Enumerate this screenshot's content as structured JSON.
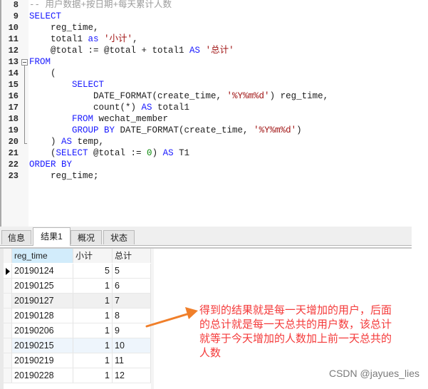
{
  "editor": {
    "lines": [
      {
        "n": "8",
        "parts": [
          {
            "t": "-- 用户数据+按日期+每天累计人数",
            "c": "cmt"
          }
        ]
      },
      {
        "n": "9",
        "parts": [
          {
            "t": "SELECT",
            "c": "kw"
          }
        ]
      },
      {
        "n": "10",
        "parts": [
          {
            "t": "    reg_time,",
            "c": ""
          }
        ]
      },
      {
        "n": "11",
        "parts": [
          {
            "t": "    total1 ",
            "c": ""
          },
          {
            "t": "as",
            "c": "kw"
          },
          {
            "t": " ",
            "c": ""
          },
          {
            "t": "'小计'",
            "c": "str"
          },
          {
            "t": ",",
            "c": ""
          }
        ]
      },
      {
        "n": "12",
        "parts": [
          {
            "t": "    @total := @total + total1 ",
            "c": ""
          },
          {
            "t": "AS",
            "c": "kw"
          },
          {
            "t": " ",
            "c": ""
          },
          {
            "t": "'总计'",
            "c": "str"
          }
        ]
      },
      {
        "n": "13",
        "parts": [
          {
            "t": "FROM",
            "c": "kw"
          }
        ]
      },
      {
        "n": "14",
        "parts": [
          {
            "t": "    (",
            "c": ""
          }
        ]
      },
      {
        "n": "15",
        "parts": [
          {
            "t": "        ",
            "c": ""
          },
          {
            "t": "SELECT",
            "c": "kw"
          }
        ]
      },
      {
        "n": "16",
        "parts": [
          {
            "t": "            DATE_FORMAT(create_time, ",
            "c": ""
          },
          {
            "t": "'%Y%m%d'",
            "c": "str"
          },
          {
            "t": ") reg_time,",
            "c": ""
          }
        ]
      },
      {
        "n": "17",
        "parts": [
          {
            "t": "            count(*) ",
            "c": ""
          },
          {
            "t": "AS",
            "c": "kw"
          },
          {
            "t": " total1",
            "c": ""
          }
        ]
      },
      {
        "n": "18",
        "parts": [
          {
            "t": "        ",
            "c": ""
          },
          {
            "t": "FROM",
            "c": "kw"
          },
          {
            "t": " wechat_member",
            "c": ""
          }
        ]
      },
      {
        "n": "19",
        "parts": [
          {
            "t": "        ",
            "c": ""
          },
          {
            "t": "GROUP BY",
            "c": "kw"
          },
          {
            "t": " DATE_FORMAT(create_time, ",
            "c": ""
          },
          {
            "t": "'%Y%m%d'",
            "c": "str"
          },
          {
            "t": ")",
            "c": ""
          }
        ]
      },
      {
        "n": "20",
        "parts": [
          {
            "t": "    ) ",
            "c": ""
          },
          {
            "t": "AS",
            "c": "kw"
          },
          {
            "t": " temp,",
            "c": ""
          }
        ]
      },
      {
        "n": "21",
        "parts": [
          {
            "t": "    (",
            "c": ""
          },
          {
            "t": "SELECT",
            "c": "kw"
          },
          {
            "t": " @total := ",
            "c": ""
          },
          {
            "t": "0",
            "c": "num"
          },
          {
            "t": ") ",
            "c": ""
          },
          {
            "t": "AS",
            "c": "kw"
          },
          {
            "t": " T1",
            "c": ""
          }
        ]
      },
      {
        "n": "22",
        "parts": [
          {
            "t": "ORDER BY",
            "c": "kw"
          }
        ]
      },
      {
        "n": "23",
        "parts": [
          {
            "t": "    reg_time;",
            "c": ""
          }
        ]
      }
    ]
  },
  "tabs": [
    {
      "label": "信息",
      "active": false
    },
    {
      "label": "结果1",
      "active": true
    },
    {
      "label": "概况",
      "active": false
    },
    {
      "label": "状态",
      "active": false
    }
  ],
  "grid": {
    "columns": [
      "reg_time",
      "小计",
      "总计"
    ],
    "rows": [
      {
        "reg_time": "20190124",
        "subtotal": "5",
        "total": "5"
      },
      {
        "reg_time": "20190125",
        "subtotal": "1",
        "total": "6"
      },
      {
        "reg_time": "20190127",
        "subtotal": "1",
        "total": "7"
      },
      {
        "reg_time": "20190128",
        "subtotal": "1",
        "total": "8"
      },
      {
        "reg_time": "20190206",
        "subtotal": "1",
        "total": "9"
      },
      {
        "reg_time": "20190215",
        "subtotal": "1",
        "total": "10"
      },
      {
        "reg_time": "20190219",
        "subtotal": "1",
        "total": "11"
      },
      {
        "reg_time": "20190228",
        "subtotal": "1",
        "total": "12"
      }
    ]
  },
  "annotation": {
    "lines": [
      "得到的结果就是每一天增加的用户，后面",
      "的总计就是每一天总共的用户数，该总计",
      "就等于今天增加的人数加上前一天总共的",
      "人数"
    ],
    "color": "#f43a3a",
    "arrow_color": "#f07f2a"
  },
  "watermark": "CSDN @jayues_lies"
}
